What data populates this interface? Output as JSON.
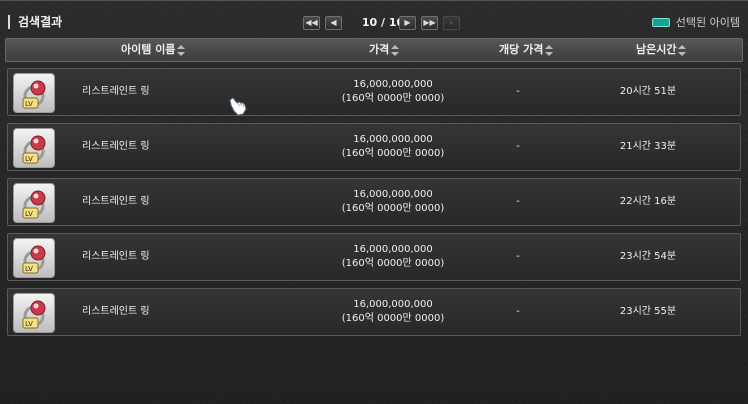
{
  "header": {
    "title": "검색결과",
    "page_text": "10 / 10",
    "legend_label": "선택된 아이템",
    "legend_color": "#17a192",
    "pager_icons": [
      "first-page-icon",
      "prev-page-icon",
      "next-page-icon",
      "last-page-icon",
      "skip-end-icon"
    ]
  },
  "columns": {
    "name": "아이템 이름",
    "price": "가격",
    "unit_price": "개당 가격",
    "time_left": "남은시간"
  },
  "rows": [
    {
      "name": "리스트레인트 링",
      "price": "16,000,000,000",
      "price_note": "(160억 0000만 0000)",
      "unit_price": "-",
      "time_left": "20시간 51분",
      "icon": "ring-icon"
    },
    {
      "name": "리스트레인트 링",
      "price": "16,000,000,000",
      "price_note": "(160억 0000만 0000)",
      "unit_price": "-",
      "time_left": "21시간 33분",
      "icon": "ring-icon"
    },
    {
      "name": "리스트레인트 링",
      "price": "16,000,000,000",
      "price_note": "(160억 0000만 0000)",
      "unit_price": "-",
      "time_left": "22시간  16분",
      "icon": "ring-icon"
    },
    {
      "name": "리스트레인트 링",
      "price": "16,000,000,000",
      "price_note": "(160억 0000만 0000)",
      "unit_price": "-",
      "time_left": "23시간 54분",
      "icon": "ring-icon"
    },
    {
      "name": "리스트레인트 링",
      "price": "16,000,000,000",
      "price_note": "(160억 0000만 0000)",
      "unit_price": "-",
      "time_left": "23시간 55분",
      "icon": "ring-icon"
    }
  ]
}
